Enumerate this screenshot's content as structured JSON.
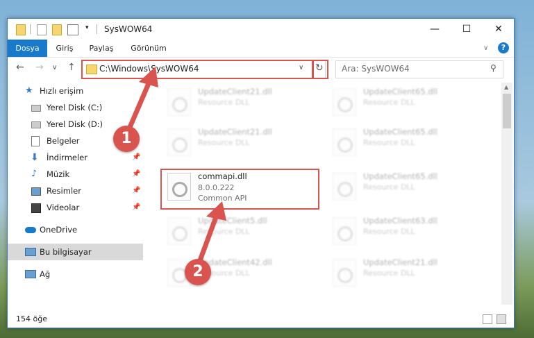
{
  "window": {
    "title": "SysWOW64",
    "controls": [
      "—",
      "☐",
      "✕"
    ]
  },
  "ribbon": {
    "tabs": [
      "Dosya",
      "Giriş",
      "Paylaş",
      "Görünüm"
    ],
    "help": "?"
  },
  "address": {
    "path": "C:\\Windows\\SysWOW64",
    "search_placeholder": "Ara: SysWOW64"
  },
  "sidebar": {
    "items": [
      {
        "label": "Hızlı erişim",
        "icon": "star-icon"
      },
      {
        "label": "Yerel Disk (C:)",
        "icon": "drive-icon"
      },
      {
        "label": "Yerel Disk (D:)",
        "icon": "drive-icon"
      },
      {
        "label": "Belgeler",
        "icon": "documents-icon"
      },
      {
        "label": "İndirmeler",
        "icon": "downloads-icon"
      },
      {
        "label": "Müzik",
        "icon": "music-icon"
      },
      {
        "label": "Resimler",
        "icon": "pictures-icon"
      },
      {
        "label": "Videolar",
        "icon": "videos-icon"
      },
      {
        "label": "OneDrive",
        "icon": "cloud-icon"
      },
      {
        "label": "Bu bilgisayar",
        "icon": "computer-icon"
      },
      {
        "label": "Ağ",
        "icon": "network-icon"
      }
    ]
  },
  "files": [
    {
      "name": "UpdateClient21.dll",
      "version": "",
      "desc": "Resource DLL",
      "blur": true
    },
    {
      "name": "UpdateClient65.dll",
      "version": "",
      "desc": "Resource DLL",
      "blur": true
    },
    {
      "name": "UpdateClient21.dll",
      "version": "",
      "desc": "Resource DLL",
      "blur": true
    },
    {
      "name": "UpdateClient65.dll",
      "version": "",
      "desc": "Resource DLL",
      "blur": true
    },
    {
      "name": "commapi.dll",
      "version": "8.0.0.222",
      "desc": "Common API",
      "blur": false
    },
    {
      "name": "UpdateClient65.dll",
      "version": "",
      "desc": "Resource DLL",
      "blur": true
    },
    {
      "name": "UpdateClient5.dll",
      "version": "",
      "desc": "Resource DLL",
      "blur": true
    },
    {
      "name": "UpdateClient63.dll",
      "version": "",
      "desc": "Resource DLL",
      "blur": true
    },
    {
      "name": "UpdateClient42.dll",
      "version": "",
      "desc": "Resource DLL",
      "blur": true
    },
    {
      "name": "UpdateClient21.dll",
      "version": "",
      "desc": "Resource DLL",
      "blur": true
    }
  ],
  "status": {
    "count": "154 öğe"
  },
  "annotations": {
    "badge1": "1",
    "badge2": "2"
  },
  "colors": {
    "accent": "#1979ca",
    "highlight": "#d9534f"
  }
}
